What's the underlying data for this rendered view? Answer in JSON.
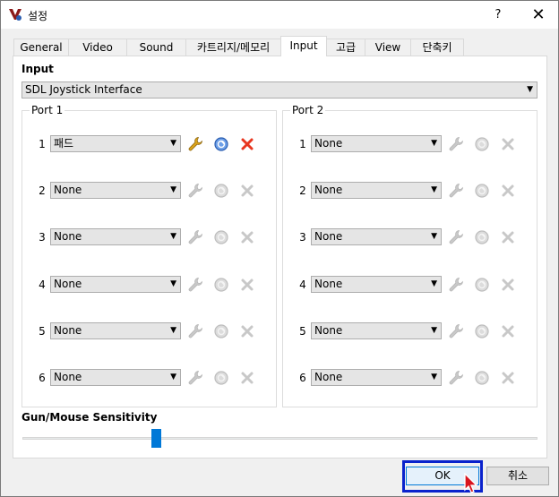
{
  "window": {
    "title": "설정",
    "help_label": "?",
    "close_label": "✕"
  },
  "tabs": [
    {
      "label": "General"
    },
    {
      "label": "Video"
    },
    {
      "label": "Sound"
    },
    {
      "label": "카트리지/메모리"
    },
    {
      "label": "Input"
    },
    {
      "label": "고급"
    },
    {
      "label": "View"
    },
    {
      "label": "단축키"
    }
  ],
  "active_tab": "Input",
  "input": {
    "heading": "Input",
    "driver": "SDL Joystick Interface"
  },
  "ports": [
    {
      "title": "Port 1",
      "rows": [
        {
          "num": "1",
          "value": "패드",
          "enabled": true
        },
        {
          "num": "2",
          "value": "None",
          "enabled": false
        },
        {
          "num": "3",
          "value": "None",
          "enabled": false
        },
        {
          "num": "4",
          "value": "None",
          "enabled": false
        },
        {
          "num": "5",
          "value": "None",
          "enabled": false
        },
        {
          "num": "6",
          "value": "None",
          "enabled": false
        }
      ]
    },
    {
      "title": "Port 2",
      "rows": [
        {
          "num": "1",
          "value": "None",
          "enabled": false
        },
        {
          "num": "2",
          "value": "None",
          "enabled": false
        },
        {
          "num": "3",
          "value": "None",
          "enabled": false
        },
        {
          "num": "4",
          "value": "None",
          "enabled": false
        },
        {
          "num": "5",
          "value": "None",
          "enabled": false
        },
        {
          "num": "6",
          "value": "None",
          "enabled": false
        }
      ]
    }
  ],
  "row_icons": [
    "wrench-icon",
    "gamepad-icon",
    "delete-icon"
  ],
  "sensitivity": {
    "label": "Gun/Mouse Sensitivity",
    "value_fraction": 0.25
  },
  "buttons": {
    "ok": "OK",
    "cancel": "취소"
  },
  "colors": {
    "accent": "#0078d7",
    "focus": "#0a22cc",
    "delete": "#e8361f",
    "wrench": "#d9a21b"
  }
}
